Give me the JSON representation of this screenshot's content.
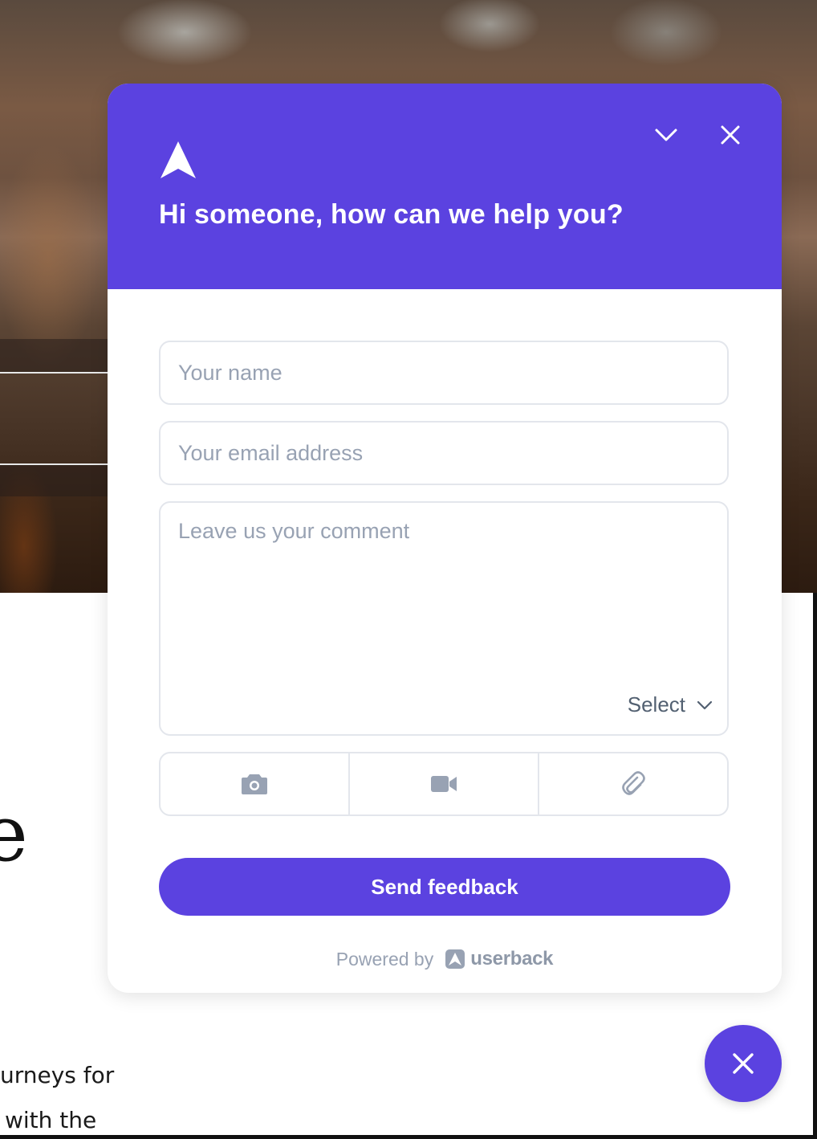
{
  "background": {
    "partial_letter": "e",
    "text_lines": [
      "urneys for",
      "with the"
    ]
  },
  "widget": {
    "header": {
      "title": "Hi someone, how can we help you?",
      "logo_icon": "userback-arrow-logo",
      "minimize_icon": "chevron-down-icon",
      "close_icon": "close-icon"
    },
    "form": {
      "name_placeholder": "Your name",
      "email_placeholder": "Your email address",
      "comment_placeholder": "Leave us your comment",
      "select_label": "Select",
      "tools": [
        "camera-icon",
        "video-icon",
        "paperclip-icon"
      ],
      "submit_label": "Send feedback"
    },
    "footer": {
      "powered_by": "Powered by",
      "brand": "userback"
    }
  },
  "launcher": {
    "icon": "close-icon"
  },
  "colors": {
    "accent": "#5b42e0",
    "placeholder": "#98a2b3",
    "border": "#e3e6ec"
  }
}
